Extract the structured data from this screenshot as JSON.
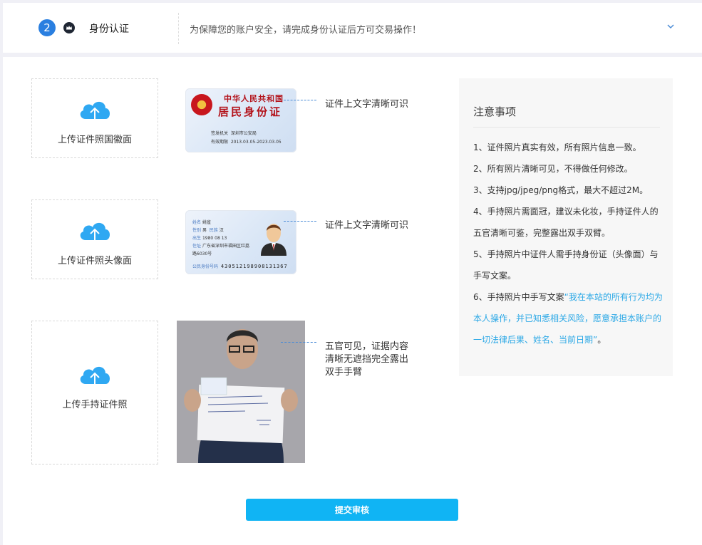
{
  "header": {
    "step_number": "2",
    "step_title": "身份认证",
    "description": "为保障您的账户安全，请完成身份认证后方可交易操作！"
  },
  "uploads": [
    {
      "label": "上传证件照国徽面",
      "tip": "证件上文字清晰可识"
    },
    {
      "label": "上传证件照头像面",
      "tip": "证件上文字清晰可识"
    },
    {
      "label": "上传手持证件照",
      "tip": "五官可见，证据内容清晰无遮挡完全露出双手手臂"
    }
  ],
  "id_front": {
    "country": "中华人民共和国",
    "card_title": "居民身份证",
    "issuer_label": "签发机关",
    "issuer_value": "深圳市公安局",
    "valid_label": "有效期限",
    "valid_value": "2013.03.05-2023.03.05"
  },
  "id_back": {
    "name_label": "姓名",
    "name_value": "姚雀",
    "sex_label": "性别",
    "sex_value": "男",
    "ethnic_label": "民族",
    "ethnic_value": "汉",
    "birth_label": "出生",
    "birth_year": "1980",
    "birth_month": "08",
    "birth_day": "13",
    "address_label": "住址",
    "address_value": "广东省深圳市福田区红荔路6030号",
    "id_label": "公民身份号码",
    "id_value": "430512198908131367"
  },
  "notice": {
    "title": "注意事项",
    "items": [
      "1、证件照片真实有效，所有照片信息一致。",
      "2、所有照片清晰可见，不得做任何修改。",
      "3、支持jpg/jpeg/png格式，最大不超过2M。",
      "4、手持照片需面冠，建议未化妆，手持证件人的五官清晰可鉴，完整露出双手双臂。",
      "5、手持照片中证件人需手持身份证（头像面）与手写文案。"
    ],
    "item6_prefix": "6、手持照片中手写文案",
    "item6_quote": "“我在本站的所有行为均为本人操作，并已知悉相关风险，愿意承担本账户的一切法律后果、姓名、当前日期”",
    "item6_suffix": "。"
  },
  "submit_label": "提交审核",
  "colors": {
    "primary": "#10b4f4",
    "step_badge": "#2a7fe0",
    "highlight": "#2ba8e6",
    "cloud": "#2fa8f2"
  },
  "icons": [
    "crown-icon",
    "chevron-down-icon",
    "cloud-upload-icon"
  ]
}
